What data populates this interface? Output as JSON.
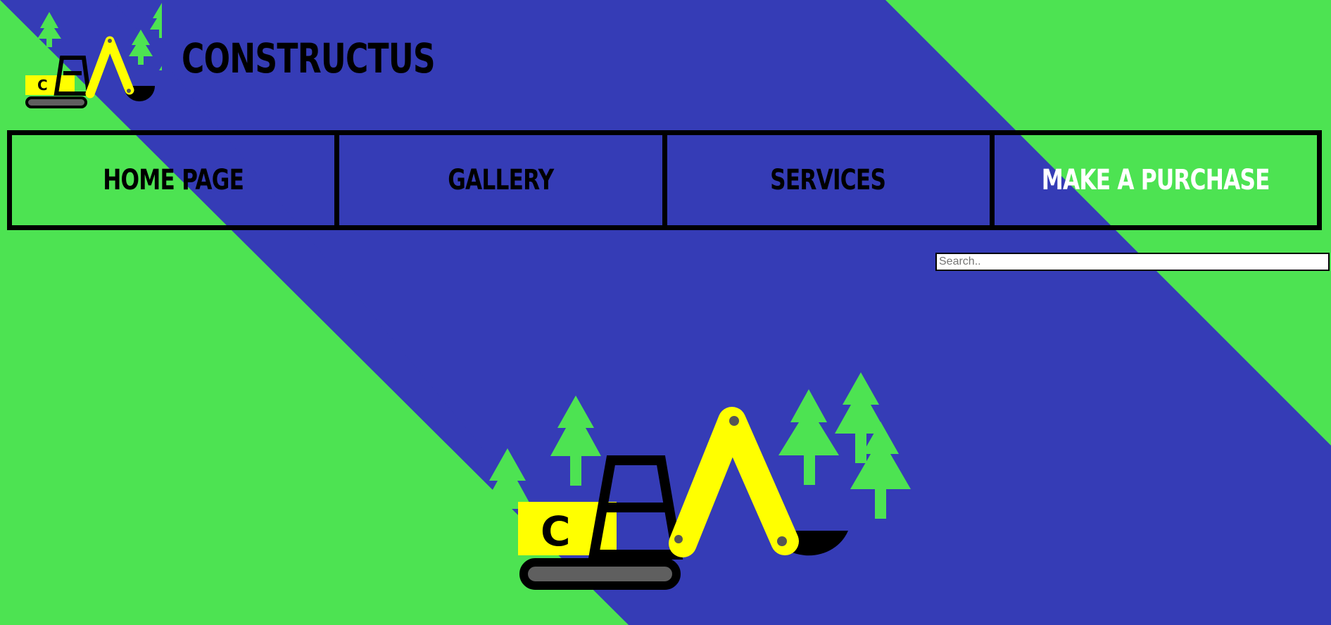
{
  "site": {
    "title": "CONSTRUCTUS"
  },
  "nav": {
    "items": [
      {
        "label": "HOME PAGE"
      },
      {
        "label": "GALLERY"
      },
      {
        "label": "SERVICES"
      },
      {
        "label": "MAKE A PURCHASE"
      }
    ]
  },
  "search": {
    "placeholder": "Search..",
    "value": ""
  },
  "logo": {
    "letter": "C"
  },
  "colors": {
    "blue": "#353cb6",
    "green": "#4de352",
    "yellow": "#ffff00",
    "black": "#000000",
    "track_gray": "#5f5f5f",
    "white": "#ffffff"
  },
  "icons": {
    "logo": "excavator-logo-icon",
    "hero": "excavator-illustration",
    "tree": "tree-icon"
  }
}
